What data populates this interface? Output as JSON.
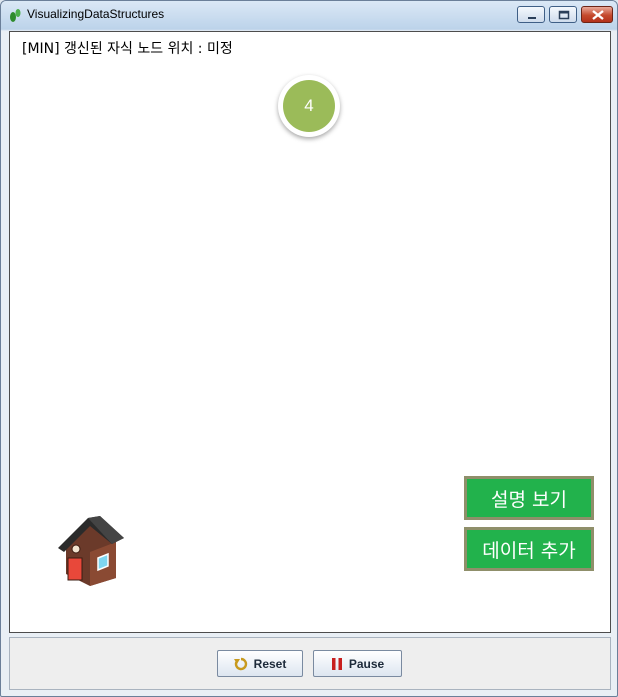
{
  "window": {
    "title": "VisualizingDataStructures"
  },
  "status_text": "[MIN] 갱신된 자식 노드 위치 : 미정",
  "node": {
    "value": "4",
    "color": "#9bbb59"
  },
  "buttons": {
    "show_description": "설명 보기",
    "add_data": "데이터 추가",
    "accent_color": "#22b24c"
  },
  "controls": {
    "reset_label": "Reset",
    "pause_label": "Pause"
  },
  "icons": [
    "app-footprint-icon",
    "minimize-icon",
    "maximize-icon",
    "close-icon",
    "house-icon",
    "reset-icon",
    "pause-icon"
  ]
}
